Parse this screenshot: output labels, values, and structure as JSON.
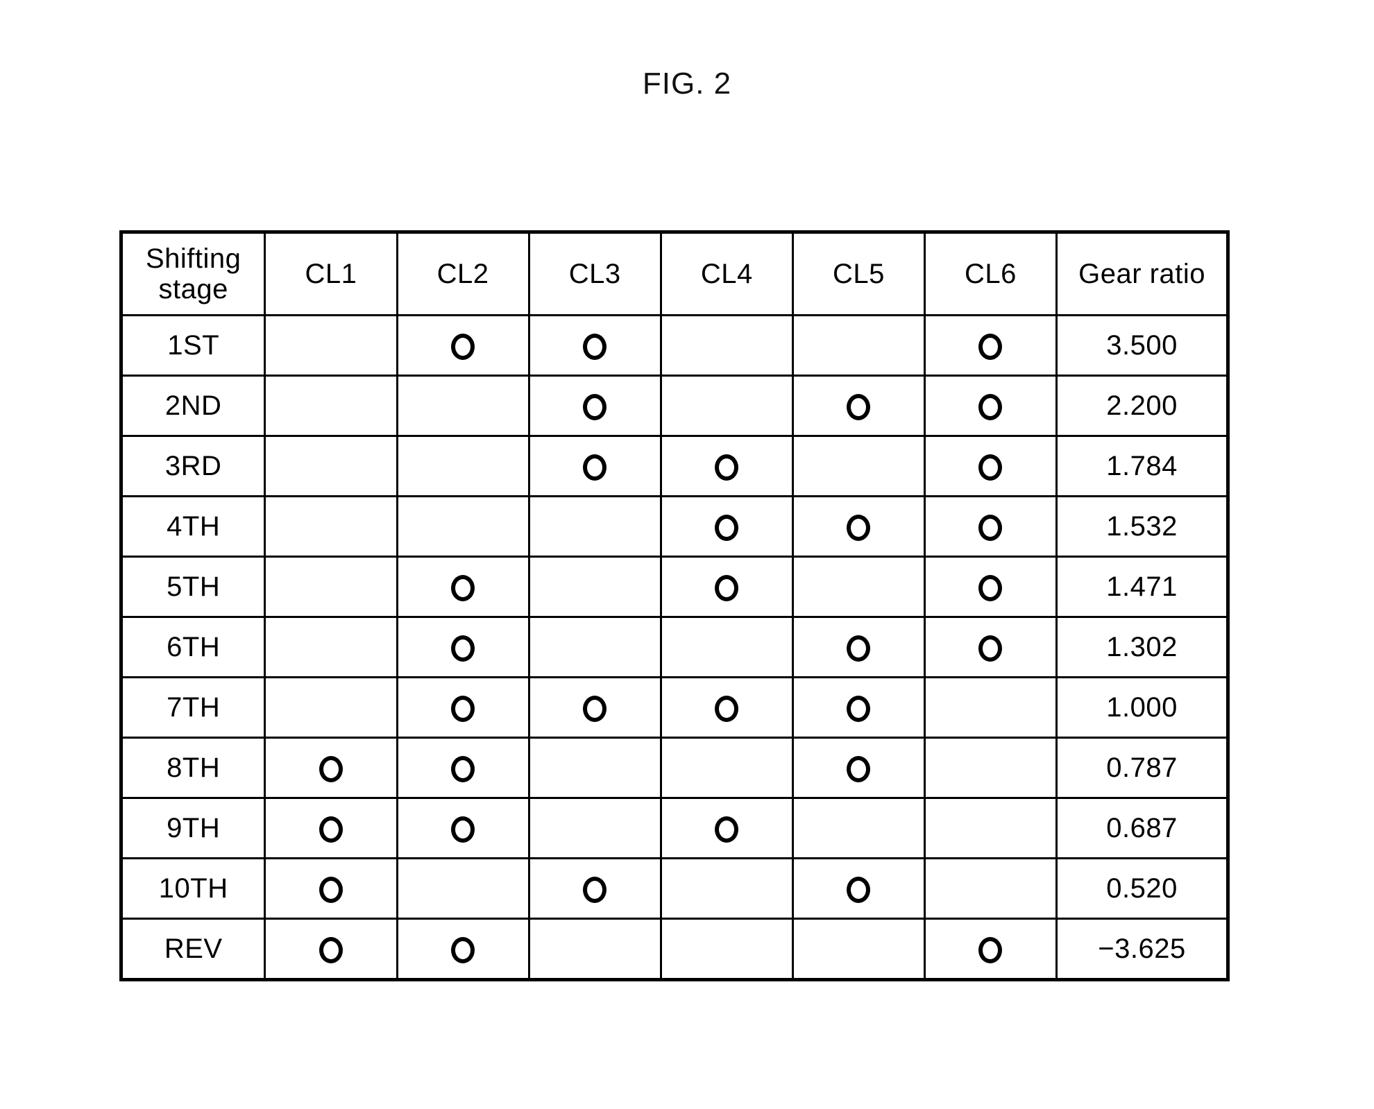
{
  "figure": {
    "title": "FIG. 2"
  },
  "table": {
    "headers": {
      "stage_line1": "Shifting",
      "stage_line2": "stage",
      "cl1": "CL1",
      "cl2": "CL2",
      "cl3": "CL3",
      "cl4": "CL4",
      "cl5": "CL5",
      "cl6": "CL6",
      "gear_ratio": "Gear ratio"
    },
    "columns": [
      "Shifting stage",
      "CL1",
      "CL2",
      "CL3",
      "CL4",
      "CL5",
      "CL6",
      "Gear ratio"
    ],
    "engagement_symbol": "circle-mark",
    "rows": [
      {
        "stage": "1ST",
        "marks": [
          false,
          true,
          true,
          false,
          false,
          true
        ],
        "gear_ratio": "3.500"
      },
      {
        "stage": "2ND",
        "marks": [
          false,
          false,
          true,
          false,
          true,
          true
        ],
        "gear_ratio": "2.200"
      },
      {
        "stage": "3RD",
        "marks": [
          false,
          false,
          true,
          true,
          false,
          true
        ],
        "gear_ratio": "1.784"
      },
      {
        "stage": "4TH",
        "marks": [
          false,
          false,
          false,
          true,
          true,
          true
        ],
        "gear_ratio": "1.532"
      },
      {
        "stage": "5TH",
        "marks": [
          false,
          true,
          false,
          true,
          false,
          true
        ],
        "gear_ratio": "1.471"
      },
      {
        "stage": "6TH",
        "marks": [
          false,
          true,
          false,
          false,
          true,
          true
        ],
        "gear_ratio": "1.302"
      },
      {
        "stage": "7TH",
        "marks": [
          false,
          true,
          true,
          true,
          true,
          false
        ],
        "gear_ratio": "1.000"
      },
      {
        "stage": "8TH",
        "marks": [
          true,
          true,
          false,
          false,
          true,
          false
        ],
        "gear_ratio": "0.787"
      },
      {
        "stage": "9TH",
        "marks": [
          true,
          true,
          false,
          true,
          false,
          false
        ],
        "gear_ratio": "0.687"
      },
      {
        "stage": "10TH",
        "marks": [
          true,
          false,
          true,
          false,
          true,
          false
        ],
        "gear_ratio": "0.520"
      },
      {
        "stage": "REV",
        "marks": [
          true,
          true,
          false,
          false,
          false,
          true
        ],
        "gear_ratio": "−3.625"
      }
    ]
  },
  "colors": {
    "background": "#ffffff",
    "ink": "#000000"
  }
}
